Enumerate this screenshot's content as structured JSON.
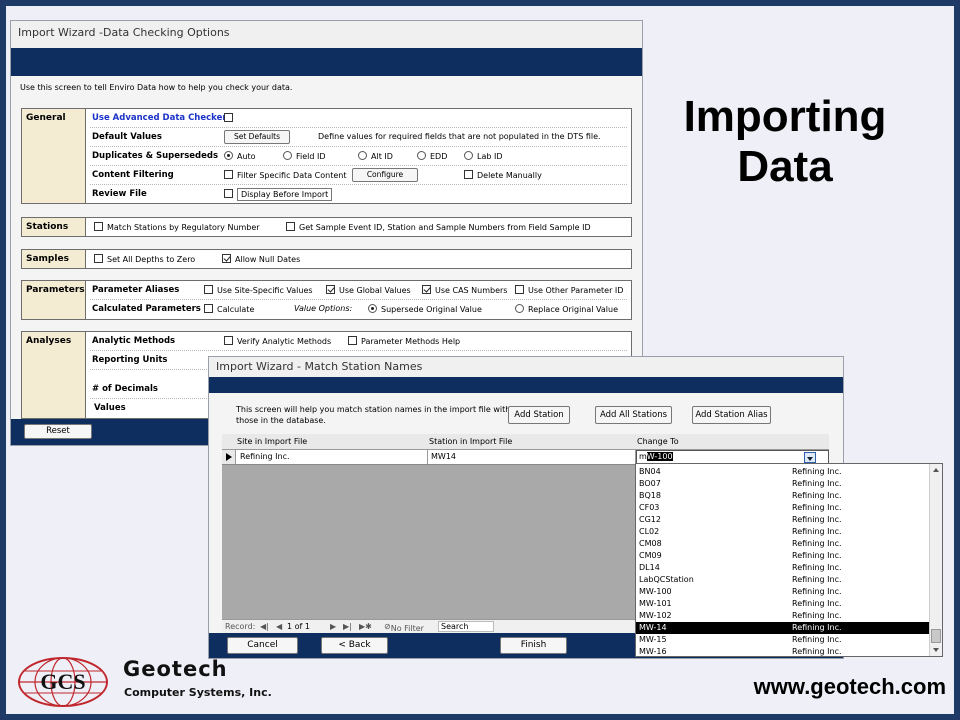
{
  "slide": {
    "heading_line1": "Importing",
    "heading_line2": "Data",
    "url": "www.geotech.com",
    "logo_initials": "GCS",
    "logo_name": "Geotech",
    "logo_sub": "Computer Systems, Inc."
  },
  "window1": {
    "title": "Import Wizard -Data Checking Options",
    "intro": "Use this screen to tell Enviro Data how to help you check your data.",
    "general": {
      "label": "General",
      "advanced_checker": "Use Advanced Data Checker",
      "default_values": "Default Values",
      "set_defaults_button": "Set Defaults",
      "default_values_desc": "Define values for required fields that are not populated in the DTS file.",
      "duplicates": "Duplicates & Supersededs",
      "opt_auto": "Auto",
      "opt_field_id": "Field ID",
      "opt_alt_id": "Alt ID",
      "opt_edd": "EDD",
      "opt_lab_id": "Lab ID",
      "content_filtering": "Content Filtering",
      "filter_specific": "Filter Specific Data Content",
      "configure_button": "Configure",
      "delete_manually": "Delete Manually",
      "review_file": "Review File",
      "display_before_import": "Display Before Import"
    },
    "stations": {
      "label": "Stations",
      "match_regulatory": "Match Stations by Regulatory Number",
      "get_sample_event": "Get Sample Event ID, Station and Sample Numbers from Field Sample ID"
    },
    "samples": {
      "label": "Samples",
      "set_depths_zero": "Set All Depths to Zero",
      "allow_null_dates": "Allow Null Dates"
    },
    "parameters": {
      "label": "Parameters",
      "aliases": "Parameter Aliases",
      "site_specific": "Use Site-Specific Values",
      "global_values": "Use Global Values",
      "cas_numbers": "Use CAS Numbers",
      "other_param_id": "Use Other Parameter ID",
      "calculated": "Calculated Parameters",
      "calculate": "Calculate",
      "value_options": "Value Options:",
      "supersede_original": "Supersede Original Value",
      "replace_original": "Replace Original Value"
    },
    "analyses": {
      "label": "Analyses",
      "analytic_methods": "Analytic Methods",
      "verify_methods": "Verify Analytic Methods",
      "methods_help": "Parameter Methods Help",
      "reporting_units": "Reporting Units",
      "num_decimals": "# of Decimals",
      "values": "Values"
    },
    "reset_button": "Reset"
  },
  "window2": {
    "title": "Import Wizard - Match Station Names",
    "instructions": "This screen will help you match station names in the import file with those in the database.",
    "add_station": "Add Station",
    "add_all_stations": "Add All Stations",
    "add_station_alias": "Add Station Alias",
    "col_site": "Site in Import File",
    "col_station": "Station in Import File",
    "col_change_to": "Change To",
    "row_site": "Refining Inc.",
    "row_station": "MW14",
    "change_to_prefix": "m",
    "change_to_selected": "W-100",
    "nav_record_label": "Record:",
    "nav_first": "◀|",
    "nav_prev": "◀",
    "nav_position": "1 of 1",
    "nav_next": "▶",
    "nav_last": "▶|",
    "nav_new": "▶✱",
    "nav_no_filter": "No Filter",
    "nav_search": "Search",
    "cancel_button": "Cancel",
    "back_button": "< Back",
    "finish_button": "Finish"
  },
  "dropdown": {
    "items": [
      {
        "station": "BN04",
        "site": "Refining Inc."
      },
      {
        "station": "BO07",
        "site": "Refining Inc."
      },
      {
        "station": "BQ18",
        "site": "Refining Inc."
      },
      {
        "station": "CF03",
        "site": "Refining Inc."
      },
      {
        "station": "CG12",
        "site": "Refining Inc."
      },
      {
        "station": "CL02",
        "site": "Refining Inc."
      },
      {
        "station": "CM08",
        "site": "Refining Inc."
      },
      {
        "station": "CM09",
        "site": "Refining Inc."
      },
      {
        "station": "DL14",
        "site": "Refining Inc."
      },
      {
        "station": "LabQCStation",
        "site": "Refining Inc."
      },
      {
        "station": "MW-100",
        "site": "Refining Inc."
      },
      {
        "station": "MW-101",
        "site": "Refining Inc."
      },
      {
        "station": "MW-102",
        "site": "Refining Inc."
      },
      {
        "station": "MW-14",
        "site": "Refining Inc.",
        "highlighted": true
      },
      {
        "station": "MW-15",
        "site": "Refining Inc."
      },
      {
        "station": "MW-16",
        "site": "Refining Inc."
      }
    ]
  }
}
